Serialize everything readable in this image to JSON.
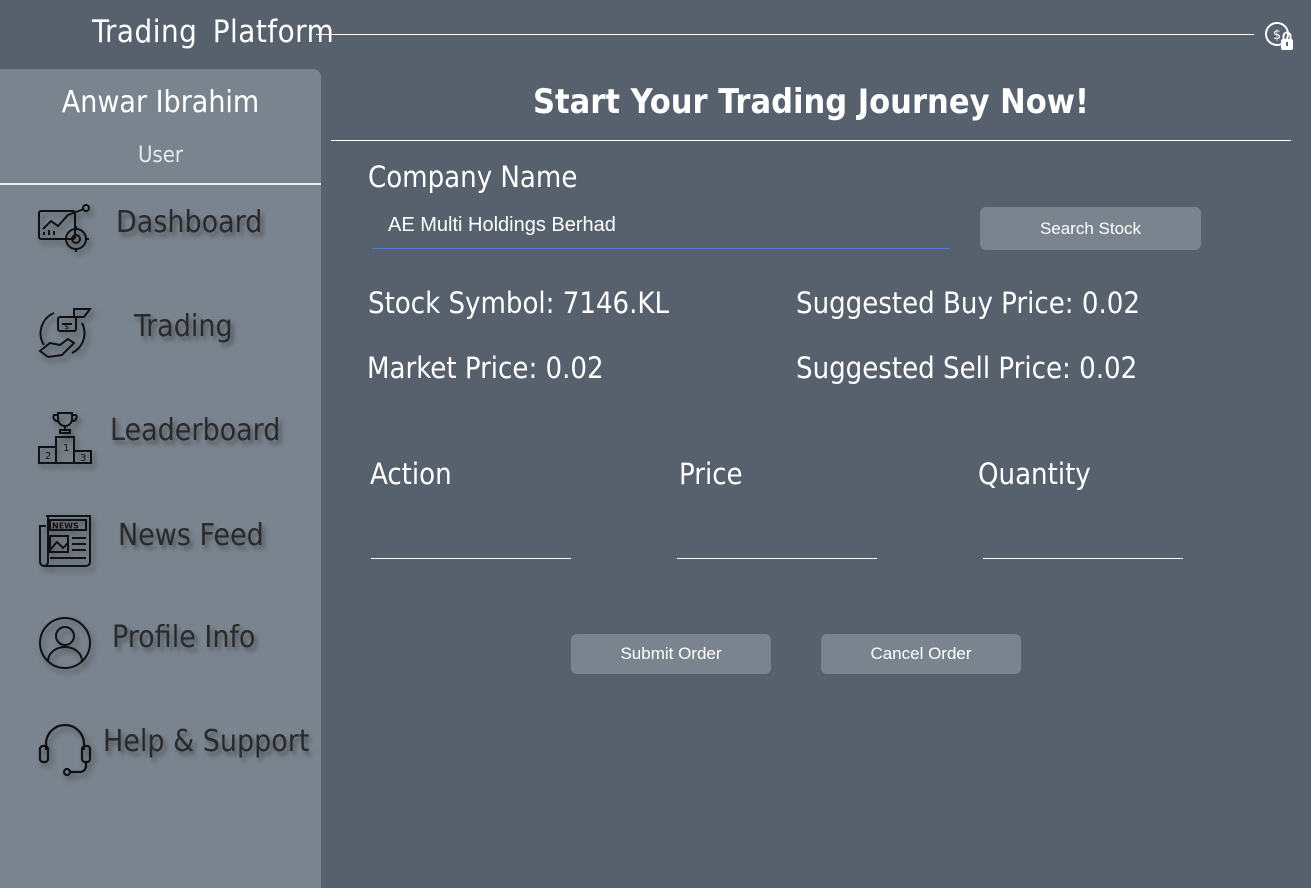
{
  "app": {
    "title": "Trading Platform"
  },
  "header": {
    "lock_icon": "dollar-lock-icon"
  },
  "sidebar": {
    "user_name": "Anwar Ibrahim",
    "user_role": "User",
    "items": [
      {
        "label": "Dashboard",
        "icon": "dashboard-icon"
      },
      {
        "label": "Trading",
        "icon": "trading-icon"
      },
      {
        "label": "Leaderboard",
        "icon": "leaderboard-icon"
      },
      {
        "label": "News Feed",
        "icon": "news-icon"
      },
      {
        "label": "Profile Info",
        "icon": "profile-icon"
      },
      {
        "label": "Help & Support",
        "icon": "headset-icon"
      }
    ]
  },
  "main": {
    "heading": "Start Your Trading Journey Now!",
    "company_label": "Company Name",
    "company_value": "AE Multi Holdings Berhad",
    "search_button": "Search Stock",
    "stock_symbol": "Stock Symbol: 7146.KL",
    "market_price": "Market Price: 0.02",
    "suggested_buy": "Suggested Buy Price: 0.02",
    "suggested_sell": "Suggested Sell Price: 0.02",
    "action_label": "Action",
    "price_label": "Price",
    "quantity_label": "Quantity",
    "action_value": "",
    "price_value": "",
    "quantity_value": "",
    "submit_button": "Submit Order",
    "cancel_button": "Cancel Order"
  },
  "colors": {
    "background": "#56616d",
    "sidebar": "#7a848e",
    "button": "#7a848e",
    "input_underline": "#4a7fd6",
    "text": "#ffffff",
    "nav_text": "#2a2a2a"
  }
}
